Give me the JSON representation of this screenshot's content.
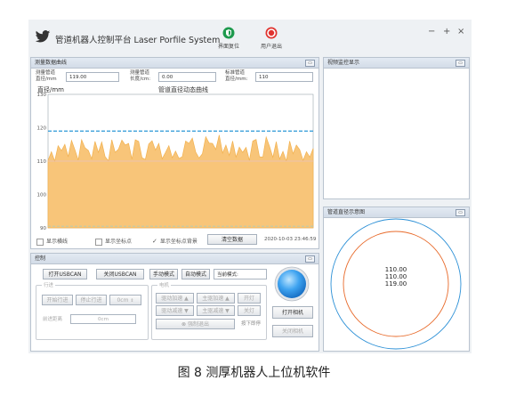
{
  "window": {
    "title": "管道机器人控制平台 Laser Porfile System",
    "btn_reset": "界面复位",
    "btn_exit": "用户退出",
    "controls": [
      "−",
      "+",
      "×"
    ]
  },
  "measure_panel": {
    "title": "测量数据曲线",
    "fields": [
      {
        "label_1": "测量管道",
        "label_2": "直径/mm",
        "value": "119.00"
      },
      {
        "label_1": "测量管道",
        "label_2": "长度/cm:",
        "value": "0.00"
      },
      {
        "label_1": "标准管道",
        "label_2": "直径/mm:",
        "value": "110"
      }
    ],
    "chart": {
      "title": "管道直径动态曲线",
      "ylabel": "直径/mm",
      "ytick_labels": [
        "130",
        "120",
        "110",
        "100",
        "90"
      ]
    },
    "options": {
      "grid": "显示横线",
      "points": "显示坐标点",
      "background": "显示坐标点背景",
      "clear_button": "清空数据",
      "timestamp": "2020-10-03 23:46:59"
    }
  },
  "video_panel": {
    "title": "视频监控显示"
  },
  "diagram_panel": {
    "title": "管道直径示意图",
    "values": [
      "110.00",
      "110.00",
      "119.00"
    ]
  },
  "control_panel": {
    "title": "控制",
    "top_buttons": {
      "open_usbcan": "打开USBCAN",
      "close_usbcan": "关闭USBCAN",
      "manual_mode": "手动模式",
      "auto_mode": "自动模式",
      "current_mode": "当前模式:"
    },
    "travel_group": {
      "title": "行进",
      "start": "开始行进",
      "stop": "停止行进",
      "speed": "0cm",
      "distance_label": "前进距离",
      "distance_value": "0cm"
    },
    "motor_group": {
      "title": "电机",
      "r1": [
        "驱动加速",
        "主驱加速",
        "开灯"
      ],
      "r2": [
        "驱动减速",
        "主驱减速",
        "关灯"
      ],
      "emergency": "强制退出",
      "emergency_note": "按下即停"
    },
    "camera": {
      "open": "打开相机",
      "close": "关闭相机"
    }
  },
  "figure_caption": "图 8   测厚机器人上位机软件",
  "chart_data": {
    "type": "area",
    "title": "管道直径动态曲线",
    "ylabel": "直径/mm",
    "ylim": [
      90,
      130
    ],
    "yticks": [
      90,
      100,
      110,
      120,
      130
    ],
    "reference_lines": [
      119,
      110,
      90.5
    ],
    "values": [
      110.2,
      112.8,
      110.0,
      114.6,
      113.1,
      115.0,
      111.3,
      116.2,
      113.4,
      110.3,
      116.4,
      114.0,
      113.2,
      110.7,
      115.9,
      112.6,
      115.7,
      111.3,
      110.1,
      116.4,
      112.6,
      113.6,
      116.3,
      114.8,
      115.3,
      110.6,
      116.4,
      115.9,
      111.0,
      110.5,
      115.1,
      116.1,
      113.3,
      115.3,
      110.7,
      112.6,
      114.6,
      111.0,
      113.0,
      110.8,
      111.3,
      116.0,
      115.3,
      116.9,
      112.7,
      110.9,
      112.2,
      117.3,
      115.4,
      115.3,
      113.5,
      117.8,
      112.4,
      114.8,
      111.7,
      116.0,
      111.2,
      114.2,
      112.6,
      114.1,
      110.2,
      116.0,
      116.5,
      111.3,
      111.2,
      117.2,
      114.4,
      111.1,
      115.8,
      110.6,
      112.9,
      110.0,
      116.0,
      112.2,
      114.8,
      113.4,
      110.2,
      112.8,
      111.2,
      113.8
    ],
    "colors": {
      "fill": "#f8c579",
      "stroke": "#f1b14f",
      "line119": "#2a98d8",
      "line110": "#e8c0c0",
      "line90": "#9dd0ca"
    }
  }
}
